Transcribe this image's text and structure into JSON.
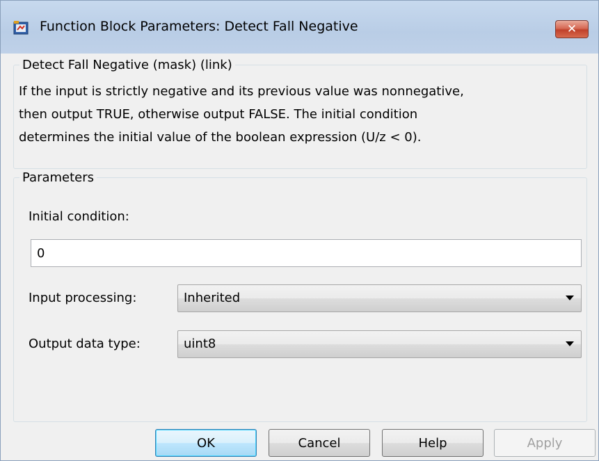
{
  "window": {
    "title": "Function Block Parameters: Detect Fall Negative",
    "close_label": "✕"
  },
  "description": {
    "legend": "Detect Fall Negative (mask) (link)",
    "lines": [
      "If the input is strictly negative and its previous value was nonnegative,",
      "then output TRUE, otherwise output FALSE.  The initial condition",
      "determines the initial value of the boolean expression (U/z < 0)."
    ]
  },
  "parameters": {
    "legend": "Parameters",
    "initial_condition_label": "Initial condition:",
    "initial_condition_value": "0",
    "input_processing_label": "Input processing:",
    "input_processing_value": "Inherited",
    "output_data_type_label": "Output data type:",
    "output_data_type_value": "uint8"
  },
  "buttons": {
    "ok": "OK",
    "cancel": "Cancel",
    "help": "Help",
    "apply": "Apply"
  },
  "icons": {
    "app": "simulink-block-icon",
    "close": "close-icon",
    "dropdown": "chevron-down-icon"
  },
  "colors": {
    "titlebar": "#c7d9ee",
    "close_button": "#c0412b",
    "default_button_border": "#3c7fb1",
    "dialog_background": "#f0f0f0"
  }
}
